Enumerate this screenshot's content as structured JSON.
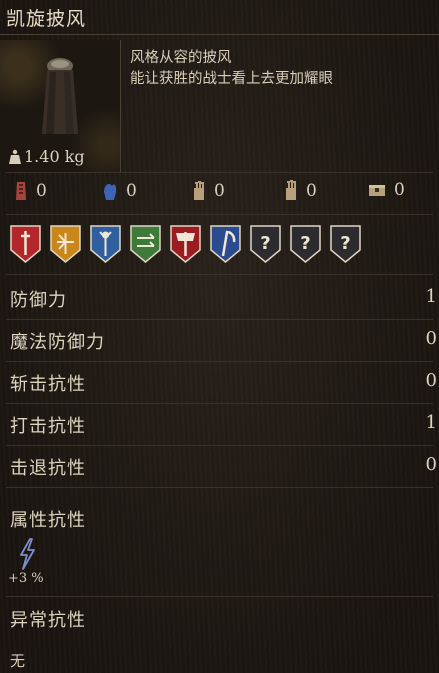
{
  "item": {
    "name": "凯旋披风",
    "weight": "1.40 kg",
    "description": [
      "风格从容的披风",
      "能让获胜的战士看上去更加耀眼"
    ]
  },
  "negation_icons": [
    {
      "icon": "bleed-hand-icon",
      "value": "0"
    },
    {
      "icon": "magic-hand-icon",
      "value": "0"
    },
    {
      "icon": "strike-hand-icon",
      "value": "0"
    },
    {
      "icon": "slash-hand-icon",
      "value": "0"
    },
    {
      "icon": "chest-icon",
      "value": "0"
    }
  ],
  "affinity_icons": [
    {
      "icon": "sword-shield-icon",
      "color": "#b3262c"
    },
    {
      "icon": "crossbow-shield-icon",
      "color": "#c8861b"
    },
    {
      "icon": "staff-shield-icon",
      "color": "#2f5f9e"
    },
    {
      "icon": "bow-shield-icon",
      "color": "#3e7a3a"
    },
    {
      "icon": "axe-shield-icon",
      "color": "#9b1d22"
    },
    {
      "icon": "scythe-shield-icon",
      "color": "#2a4c8e"
    },
    {
      "icon": "unknown-shield-icon",
      "color": "#2b2b30"
    },
    {
      "icon": "unknown-shield-icon",
      "color": "#2b2b30"
    },
    {
      "icon": "unknown-shield-icon",
      "color": "#2b2b30"
    }
  ],
  "unknown_mark": "?",
  "stats": [
    {
      "label": "防御力",
      "value": "1"
    },
    {
      "label": "魔法防御力",
      "value": "0"
    },
    {
      "label": "斩击抗性",
      "value": "0"
    },
    {
      "label": "打击抗性",
      "value": "1"
    },
    {
      "label": "击退抗性",
      "value": "0"
    }
  ],
  "attribute_resistance": {
    "label": "属性抗性",
    "icon": "lightning-icon",
    "value": "+3 %"
  },
  "abnormal_resistance": {
    "label": "异常抗性",
    "value": "无"
  }
}
